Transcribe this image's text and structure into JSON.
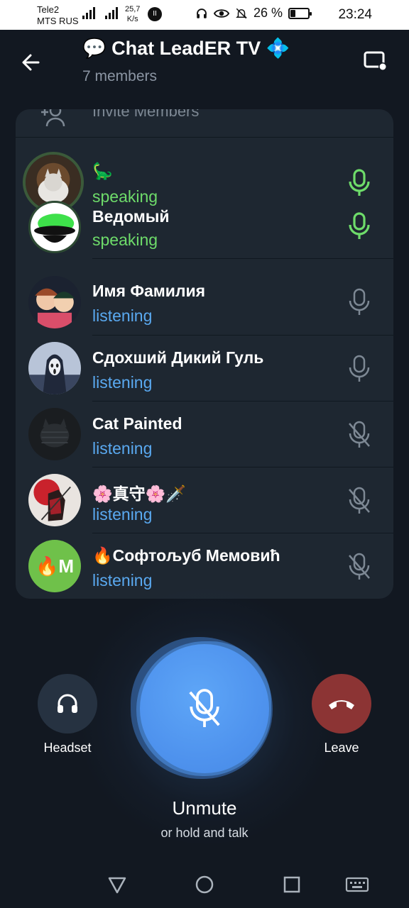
{
  "statusbar": {
    "carrier1": "Tele2",
    "carrier2": "MTS RUS",
    "net_speed_value": "25,7",
    "net_speed_unit": "K/s",
    "battery_percent": "26 %",
    "battery_level": 0.26,
    "time": "23:24"
  },
  "header": {
    "title": "💬 Chat LeadER TV 💠",
    "subtitle": "7 members",
    "back_icon": "arrow-left-icon",
    "cast_icon": "screen-share-icon"
  },
  "invite": {
    "label": "Invite Members",
    "icon": "add-user-icon"
  },
  "participants": [
    {
      "name": "🦕",
      "status": "speaking",
      "mic": "mic-active"
    },
    {
      "name": "Ведомый",
      "status": "speaking",
      "mic": "mic-active"
    },
    {
      "name": "Имя Фамилия",
      "status": "listening",
      "mic": "mic"
    },
    {
      "name": "Сдохший Дикий Гуль",
      "status": "listening",
      "mic": "mic"
    },
    {
      "name": "Cat Painted",
      "status": "listening",
      "mic": "mic-muted"
    },
    {
      "name": "🌸真守🌸🗡️",
      "status": "listening",
      "mic": "mic-muted"
    },
    {
      "name": "🔥Софтољуб Мемовић",
      "status": "listening",
      "mic": "mic-muted",
      "avatar_letters": "🔥M"
    }
  ],
  "controls": {
    "headset_label": "Headset",
    "leave_label": "Leave",
    "unmute_label": "Unmute",
    "unmute_hint": "or hold and talk"
  },
  "colors": {
    "background": "#121821",
    "card": "#1e2731",
    "speaking": "#6edc6a",
    "listening": "#5aa9f0",
    "unmute": "#4f93ee",
    "leave": "#8c3434"
  }
}
